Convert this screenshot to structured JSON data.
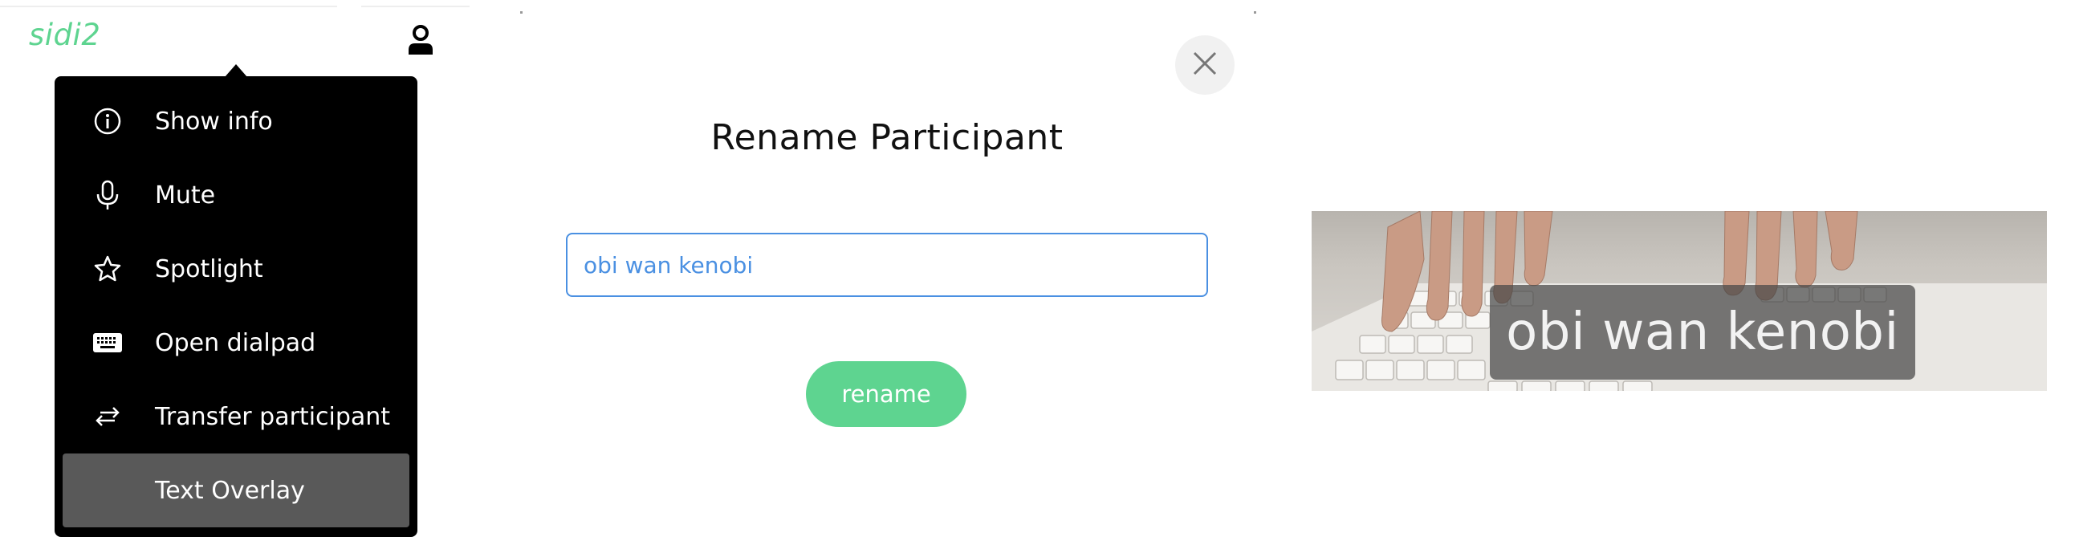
{
  "participant": {
    "name": "sidi2",
    "avatar_icon": "user-icon"
  },
  "context_menu": {
    "items": [
      {
        "label": "Show info",
        "icon": "info-icon"
      },
      {
        "label": "Mute",
        "icon": "microphone-icon"
      },
      {
        "label": "Spotlight",
        "icon": "star-icon"
      },
      {
        "label": "Open dialpad",
        "icon": "keyboard-icon"
      },
      {
        "label": "Transfer participant",
        "icon": "transfer-icon"
      },
      {
        "label": "Text Overlay",
        "icon": "",
        "active": true
      }
    ]
  },
  "rename_dialog": {
    "title": "Rename Participant",
    "input_value": "obi wan kenobi",
    "submit_label": "rename",
    "close_icon": "close-icon"
  },
  "video_tile": {
    "overlay_text": "obi wan kenobi"
  },
  "colors": {
    "brand_green": "#5ed490",
    "menu_bg": "#000000",
    "menu_active_bg": "#595959",
    "input_border": "#4a90e2"
  }
}
